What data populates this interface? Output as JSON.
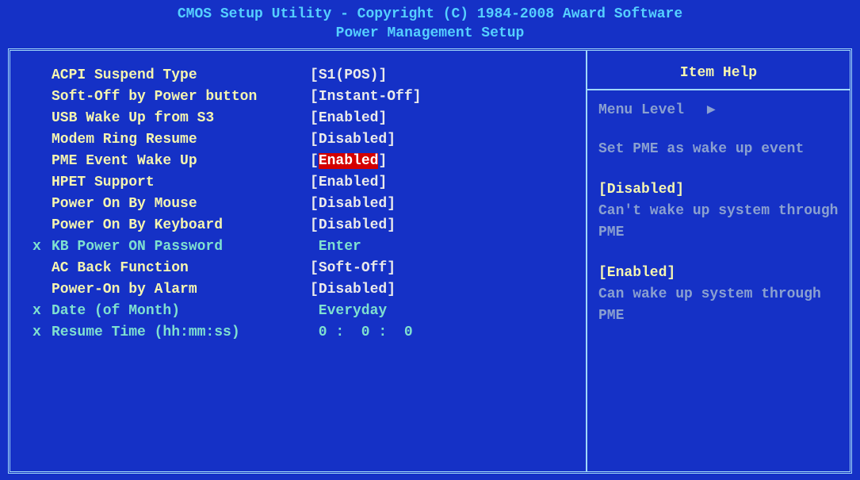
{
  "header": {
    "title": "CMOS Setup Utility - Copyright (C) 1984-2008 Award Software",
    "subtitle": "Power Management Setup"
  },
  "settings": [
    {
      "marker": "",
      "label": "ACPI Suspend Type",
      "value": "S1(POS)",
      "bracketed": true,
      "inactive": false,
      "selected": false
    },
    {
      "marker": "",
      "label": "Soft-Off by Power button",
      "value": "Instant-Off",
      "bracketed": true,
      "inactive": false,
      "selected": false
    },
    {
      "marker": "",
      "label": "USB Wake Up from S3",
      "value": "Enabled",
      "bracketed": true,
      "inactive": false,
      "selected": false
    },
    {
      "marker": "",
      "label": "Modem Ring Resume",
      "value": "Disabled",
      "bracketed": true,
      "inactive": false,
      "selected": false
    },
    {
      "marker": "",
      "label": "PME Event Wake Up",
      "value": "Enabled",
      "bracketed": true,
      "inactive": false,
      "selected": true
    },
    {
      "marker": "",
      "label": "HPET Support",
      "value": "Enabled",
      "bracketed": true,
      "inactive": false,
      "selected": false
    },
    {
      "marker": "",
      "label": "Power On By Mouse",
      "value": "Disabled",
      "bracketed": true,
      "inactive": false,
      "selected": false
    },
    {
      "marker": "",
      "label": "Power On By Keyboard",
      "value": "Disabled",
      "bracketed": true,
      "inactive": false,
      "selected": false
    },
    {
      "marker": "x",
      "label": "KB Power ON Password",
      "value": "Enter",
      "bracketed": false,
      "inactive": true,
      "selected": false
    },
    {
      "marker": "",
      "label": "AC Back Function",
      "value": "Soft-Off",
      "bracketed": true,
      "inactive": false,
      "selected": false
    },
    {
      "marker": "",
      "label": "Power-On by Alarm",
      "value": "Disabled",
      "bracketed": true,
      "inactive": false,
      "selected": false
    },
    {
      "marker": "x",
      "label": "Date (of Month)",
      "value": "Everyday",
      "bracketed": false,
      "inactive": true,
      "selected": false
    },
    {
      "marker": "x",
      "label": "Resume Time (hh:mm:ss)",
      "value": "0 :  0 :  0",
      "bracketed": false,
      "inactive": true,
      "selected": false
    }
  ],
  "help": {
    "title": "Item Help",
    "menuLevelLabel": "Menu Level",
    "description": "Set PME as wake up event",
    "options": [
      {
        "head": "[Disabled]",
        "text": "Can't wake up system through PME"
      },
      {
        "head": "[Enabled]",
        "text": "Can wake up system through PME"
      }
    ]
  }
}
